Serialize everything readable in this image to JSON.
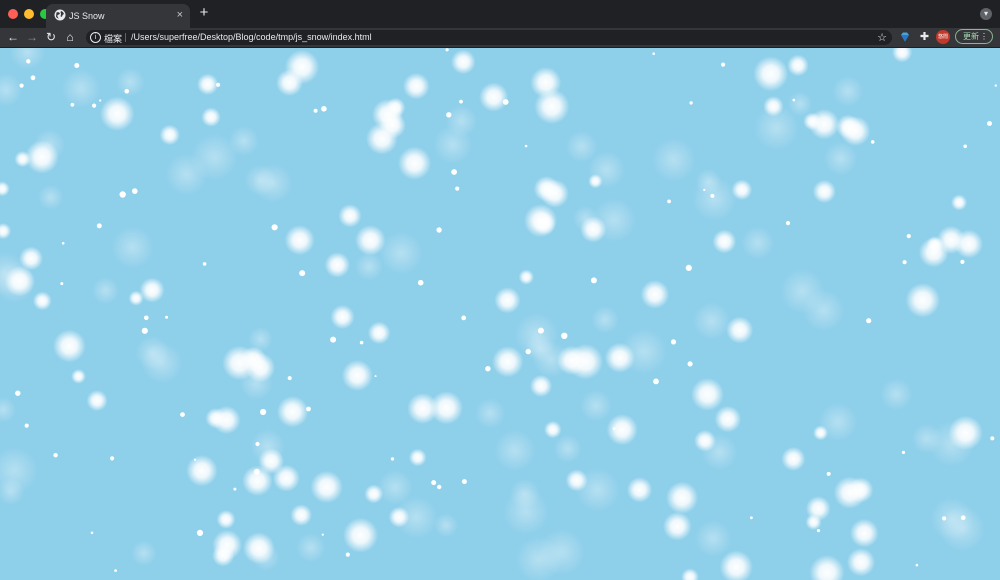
{
  "window": {
    "tab_title": "JS Snow",
    "tab_close_glyph": "×",
    "new_tab_glyph": "+",
    "tab_search_glyph": "▾"
  },
  "toolbar": {
    "back_glyph": "←",
    "forward_glyph": "→",
    "reload_glyph": "↻",
    "home_glyph": "⌂",
    "site_info_glyph": "i",
    "site_label": "檔案",
    "url": "/Users/superfree/Desktop/Blog/code/tmp/js_snow/index.html",
    "bookmark_glyph": "☆",
    "extensions_glyph": "✚",
    "profile_label": "悠閒",
    "update_label": "更新",
    "menu_glyph": "⋮"
  },
  "colors": {
    "page_background": "#8ecfea",
    "snow": "#ffffff",
    "browser_chrome": "#35363a",
    "tab_strip": "#202124"
  },
  "icons": {
    "tab_favicon": "globe-icon",
    "extension_1": "diamond-icon",
    "extension_2": "puzzle-icon"
  }
}
